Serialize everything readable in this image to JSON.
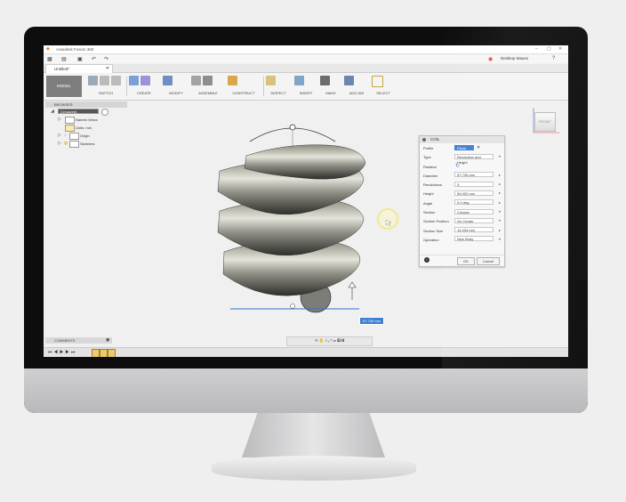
{
  "window": {
    "title": "Autodesk Fusion 360",
    "user": "Desktop Maxes",
    "help": "?"
  },
  "document_tab": {
    "label": "Untitled*"
  },
  "ribbon": {
    "workspace": "MODEL",
    "groups": [
      "SKETCH",
      "CREATE",
      "MODIFY",
      "ASSEMBLE",
      "CONSTRUCT",
      "INSPECT",
      "INSERT",
      "MAKE",
      "ADD-INS",
      "SELECT"
    ]
  },
  "browser": {
    "header": "BROWSER",
    "root": "(Unsaved)",
    "items": [
      "Named Views",
      "Units: mm",
      "Origin",
      "Sketches"
    ]
  },
  "viewcube": {
    "face": "FRONT"
  },
  "coil_dialog": {
    "title": "COIL",
    "rows": [
      {
        "label": "Profile",
        "value": "Plane"
      },
      {
        "label": "Type",
        "value": "Revolution and Height"
      },
      {
        "label": "Rotation",
        "value": "↻"
      },
      {
        "label": "Diameter",
        "value": "57.730 mm"
      },
      {
        "label": "Revolutions",
        "value": "3"
      },
      {
        "label": "Height",
        "value": "54.902 mm"
      },
      {
        "label": "Angle",
        "value": "0.0 deg"
      },
      {
        "label": "Section",
        "value": "Circular"
      },
      {
        "label": "Section Position",
        "value": "On Center"
      },
      {
        "label": "Section Size",
        "value": "14.434 mm"
      },
      {
        "label": "Operation",
        "value": "New Body"
      }
    ],
    "ok": "OK",
    "cancel": "Cancel"
  },
  "viewport": {
    "dimension_input": "57.730 mm"
  },
  "comments": {
    "label": "COMMENTS"
  }
}
